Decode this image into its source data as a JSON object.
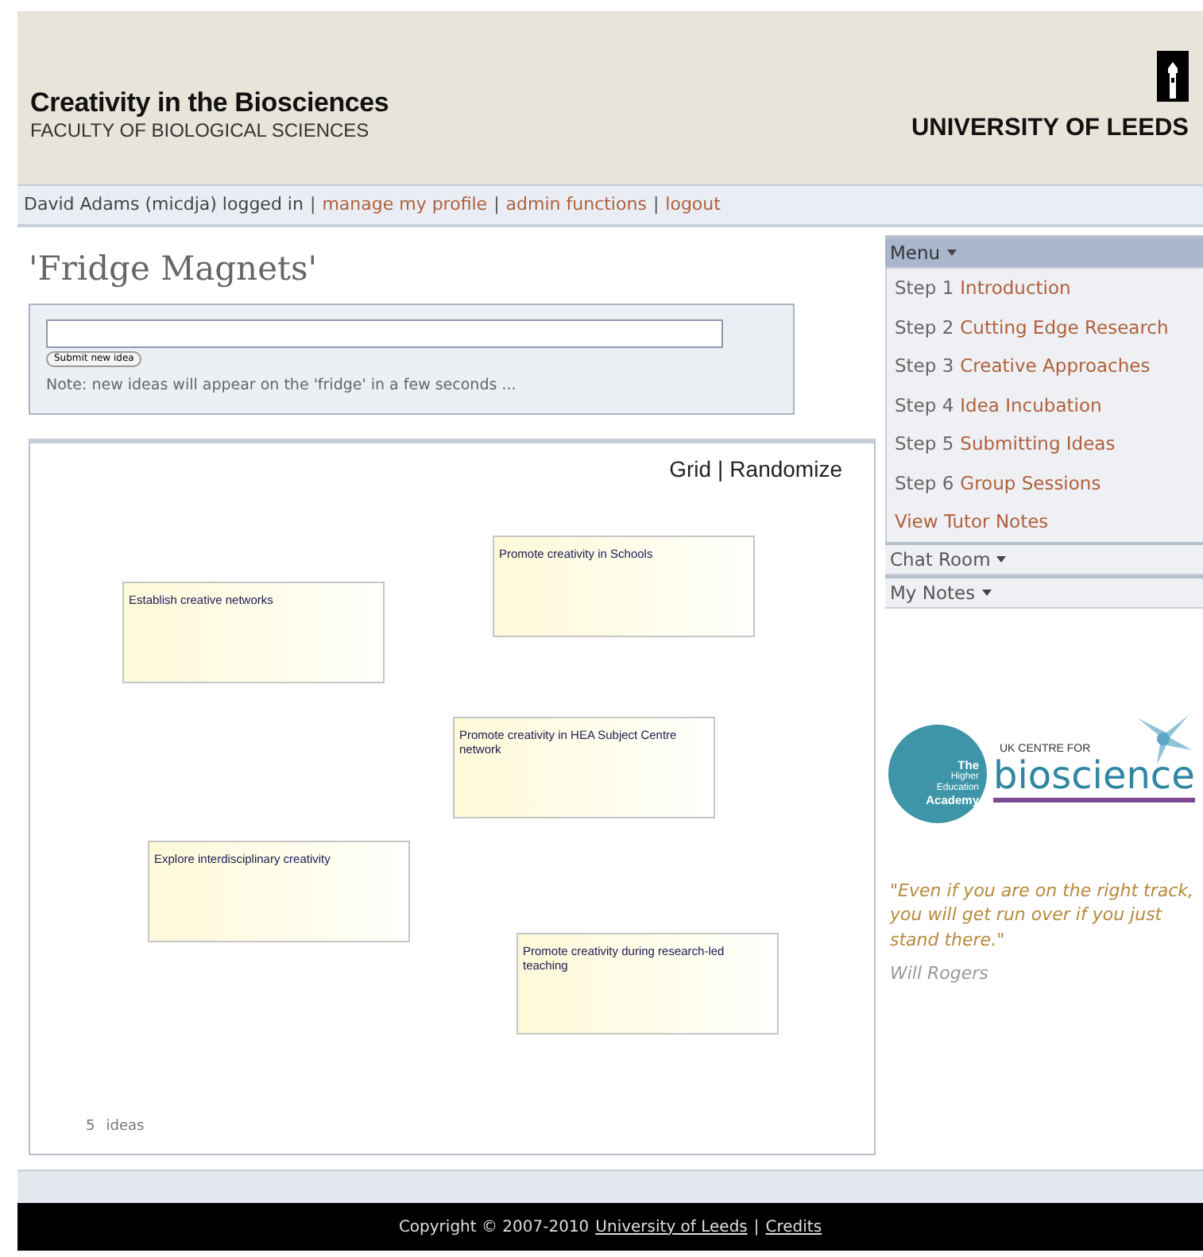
{
  "header": {
    "title": "Creativity in the Biosciences",
    "subtitle": "FACULTY OF BIOLOGICAL SCIENCES",
    "university": "UNIVERSITY OF LEEDS"
  },
  "login_bar": {
    "user": "David Adams (micdja) logged in",
    "separator": "|",
    "links": [
      "manage my profile",
      "admin functions",
      "logout"
    ]
  },
  "page_title": "'Fridge Magnets'",
  "idea_form": {
    "button": "Submit new idea",
    "note": "Note: new ideas will appear on the 'fridge' in a few seconds ..."
  },
  "board": {
    "views": [
      "Grid",
      "Randomize"
    ],
    "separator": "|",
    "magnets": [
      {
        "text": "Promote creativity in Schools"
      },
      {
        "text": "Establish creative networks"
      },
      {
        "text": "Promote creativity in HEA Subject Centre network"
      },
      {
        "text": "Explore interdisciplinary creativity"
      },
      {
        "text": "Promote creativity during research-led teaching"
      }
    ],
    "count": "5",
    "count_label": "ideas"
  },
  "sidebar": {
    "sections": [
      {
        "title": "Menu",
        "expanded": true,
        "items": [
          {
            "prefix": "Step 1",
            "label": "Introduction"
          },
          {
            "prefix": "Step 2",
            "label": "Cutting Edge Research"
          },
          {
            "prefix": "Step 3",
            "label": "Creative Approaches"
          },
          {
            "prefix": "Step 4",
            "label": "Idea Incubation"
          },
          {
            "prefix": "Step 5",
            "label": "Submitting Ideas"
          },
          {
            "prefix": "Step 6",
            "label": "Group Sessions"
          },
          {
            "label": "View Tutor Notes"
          }
        ]
      },
      {
        "title": "Chat Room",
        "expanded": false
      },
      {
        "title": "My Notes",
        "expanded": false
      }
    ],
    "logo": {
      "academy": [
        "The",
        "Higher",
        "Education",
        "Academy"
      ],
      "centre": "UK CENTRE FOR",
      "name": "bioscience"
    },
    "quote": "\"Even if you are on the right track, you will get run over if you just stand there.\"",
    "author": "Will Rogers"
  },
  "footer": {
    "copyright": "Copyright © 2007-2010",
    "links": [
      "University of Leeds",
      "Credits"
    ],
    "separator": "|"
  }
}
